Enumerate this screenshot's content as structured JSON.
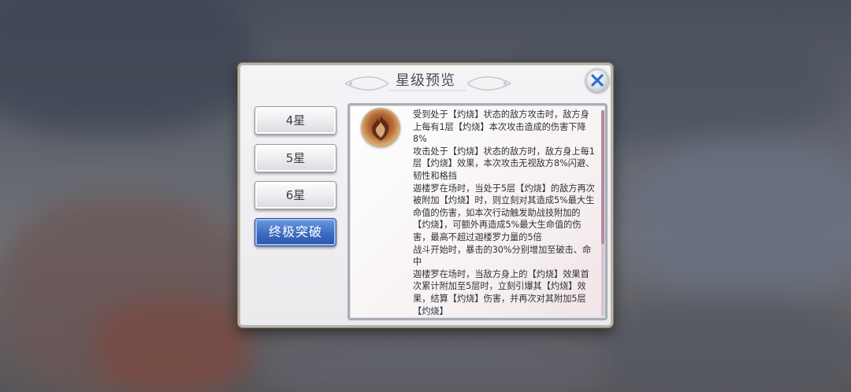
{
  "dialog": {
    "title": "星级预览",
    "close_icon": "close-icon"
  },
  "star_levels": [
    {
      "label": "4星",
      "selected": false
    },
    {
      "label": "5星",
      "selected": false
    },
    {
      "label": "6星",
      "selected": false
    },
    {
      "label": "终极突破",
      "selected": true
    }
  ],
  "skill": {
    "icon": "skill-portrait-icon",
    "description": "受到处于【灼烧】状态的敌方攻击时，敌方身上每有1层【灼烧】本次攻击造成的伤害下降8%\n攻击处于【灼烧】状态的敌方时，敌方身上每1层【灼烧】效果，本次攻击无视敌方8%闪避、韧性和格挡\n迦楼罗在场时，当处于5层【灼烧】的敌方再次被附加【灼烧】时，则立刻对其造成5%最大生命值的伤害，如本次行动触发助战技附加的【灼烧】，可额外再造成5%最大生命值的伤害，最高不超过迦楼罗力量的5倍\n战斗开始时，暴击的30%分别增加至破击、命中\n迦楼罗在场时，当敌方身上的【灼烧】效果首次累计附加至5层时，立刻引爆其【灼烧】效果，结算【灼烧】伤害，并再次对其附加5层【灼烧】"
  },
  "colors": {
    "selected_button": "#3d6cc4",
    "close_button_x": "#2f6fd0"
  }
}
